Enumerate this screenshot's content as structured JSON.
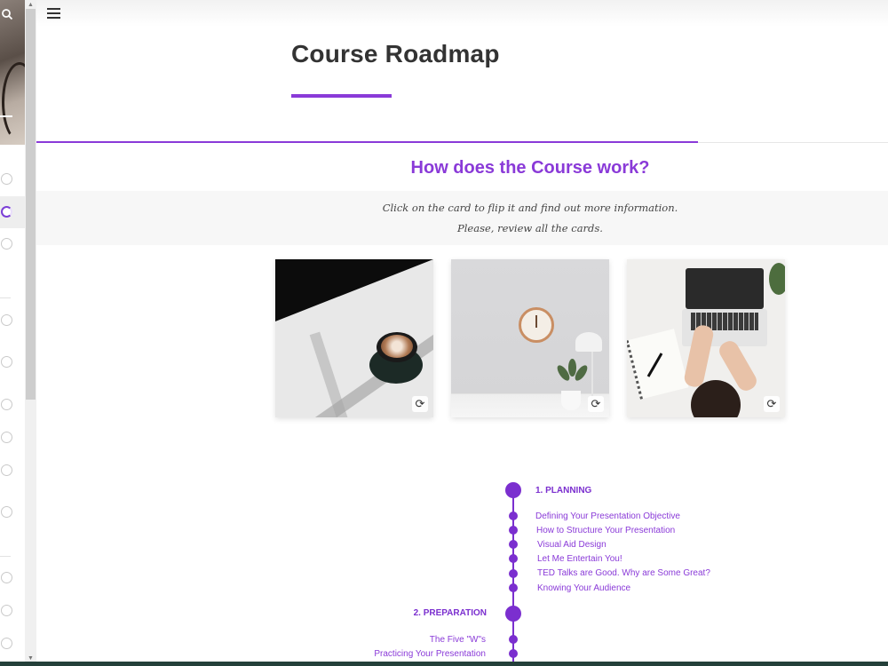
{
  "page": {
    "title": "Course Roadmap",
    "accent_color": "#8a3ad8"
  },
  "section": {
    "heading": "How does the Course work?",
    "instructions": [
      "Click on the card to flip it and find out more information.",
      "Please, review all the cards."
    ]
  },
  "cards": [
    {
      "image": "coffee-cup-shadows",
      "flip_icon": "flip-icon"
    },
    {
      "image": "clock-plant-lamp",
      "flip_icon": "flip-icon"
    },
    {
      "image": "laptop-desk-notebook",
      "flip_icon": "flip-icon"
    }
  ],
  "roadmap": {
    "phases": [
      {
        "label": "1. PLANNING",
        "items": [
          "Defining Your Presentation Objective",
          "How to Structure Your Presentation",
          "Visual Aid Design",
          "Let Me Entertain You!",
          "TED Talks are Good. Why are Some Great?",
          "Knowing Your Audience"
        ]
      },
      {
        "label": "2. PREPARATION",
        "items": [
          "The Five \"W\"s",
          "Practicing Your Presentation"
        ]
      }
    ]
  },
  "icons": {
    "menu": "menu-icon",
    "search": "search-icon",
    "status": "status-circle-icon"
  }
}
